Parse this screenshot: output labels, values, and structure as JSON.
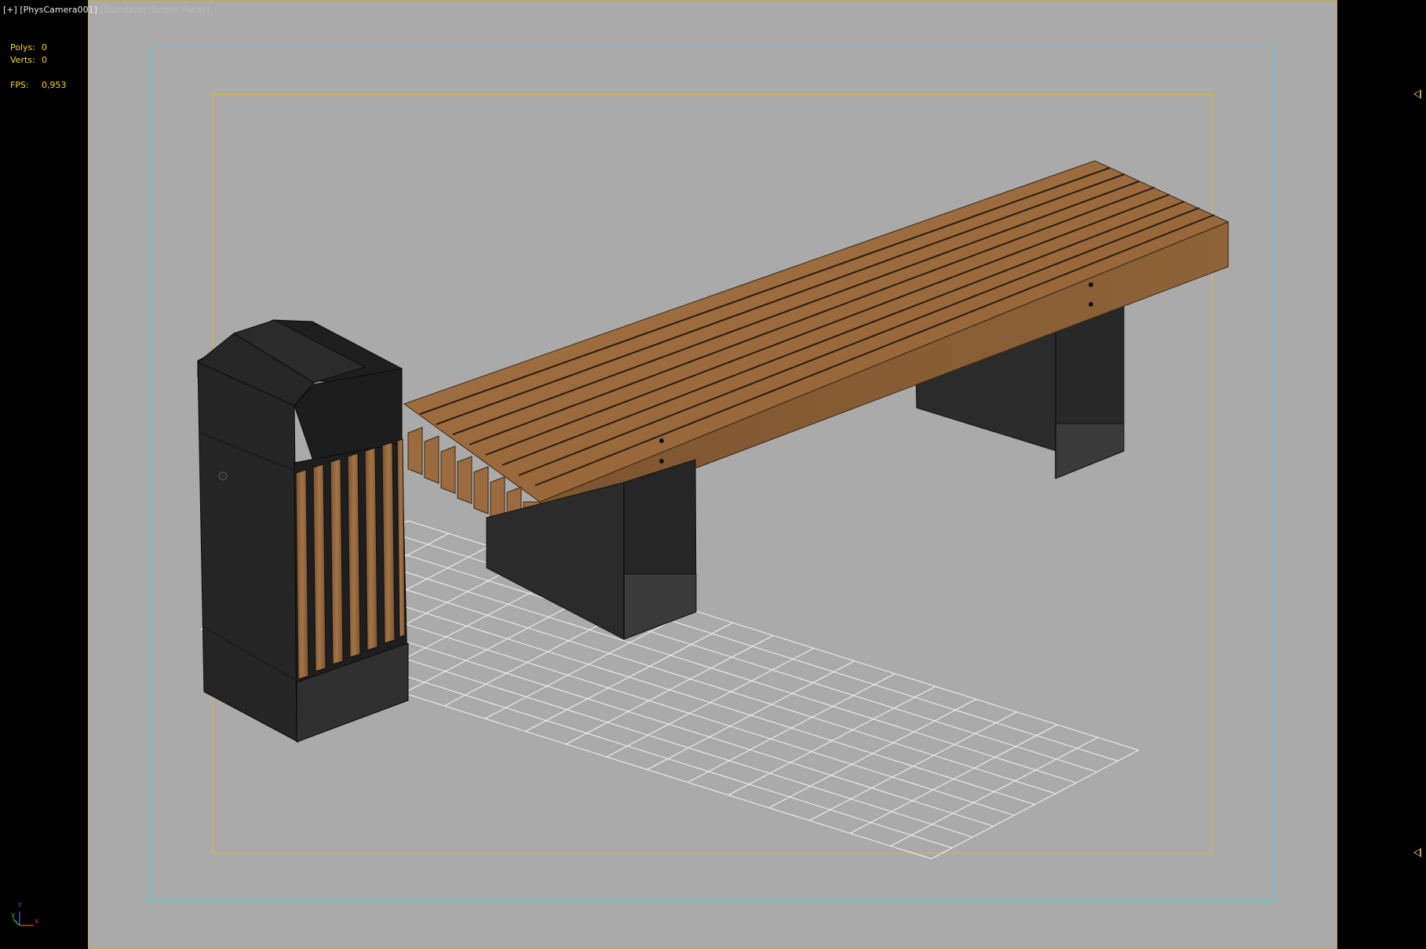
{
  "viewport": {
    "label": {
      "bracket": "[+]",
      "camera": "[PhysCamera001]",
      "shading": "[Standard]",
      "mode": "[Edged Faces]"
    },
    "stats": {
      "polys_label": "Polys:",
      "polys_value": "0",
      "verts_label": "Verts:",
      "verts_value": "0",
      "fps_label": "FPS:",
      "fps_value": "0,953"
    },
    "axis": {
      "x": "x",
      "y": "y",
      "z": "z"
    }
  },
  "colors": {
    "background": "#000000",
    "canvas": "#aaaaaa",
    "viewport_border": "#c6a64a",
    "safe_frame_outer": "#4ed0df",
    "safe_frame_inner": "#e2b33c",
    "grid": "#f0f0f0",
    "wood": "#8e6234",
    "metal": "#262626",
    "text": "#ffd700"
  },
  "icons": [
    "axis-tripod-icon",
    "safe-frame-marker-icon"
  ]
}
